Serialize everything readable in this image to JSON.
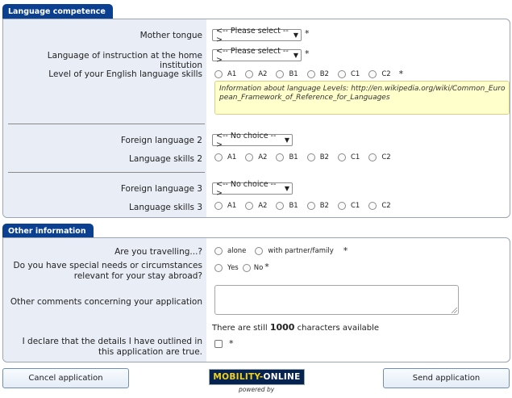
{
  "language_section": {
    "title": "Language competence",
    "mother_tongue": {
      "label": "Mother tongue",
      "value": "<-- Please select -->",
      "required": "*"
    },
    "instruction_language": {
      "label": "Language of instruction at the home institution",
      "value": "<-- Please select -->",
      "required": "*"
    },
    "english_skills": {
      "label": "Level of your English language skills",
      "options": [
        "A1",
        "A2",
        "B1",
        "B2",
        "C1",
        "C2"
      ],
      "required": "*"
    },
    "info_box": "Information about language Levels: http://en.wikipedia.org/wiki/Common_European_Framework_of_Reference_for_Languages",
    "foreign_language_2": {
      "label": "Foreign language 2",
      "value": "<-- No choice -->"
    },
    "language_skills_2": {
      "label": "Language skills 2",
      "options": [
        "A1",
        "A2",
        "B1",
        "B2",
        "C1",
        "C2"
      ]
    },
    "foreign_language_3": {
      "label": "Foreign language 3",
      "value": "<-- No choice -->"
    },
    "language_skills_3": {
      "label": "Language skills 3",
      "options": [
        "A1",
        "A2",
        "B1",
        "B2",
        "C1",
        "C2"
      ]
    }
  },
  "other_section": {
    "title": "Other information",
    "travelling": {
      "label": "Are you travelling...?",
      "options": [
        "alone",
        "with partner/family"
      ],
      "required": "*"
    },
    "special_needs": {
      "label": "Do you have special needs or circumstances relevant for your stay abroad?",
      "options": [
        "Yes",
        "No"
      ],
      "required": "*"
    },
    "comments": {
      "label": "Other comments concerning your application",
      "value": ""
    },
    "chars_prefix": "There are still",
    "chars_count": "1000",
    "chars_suffix": "characters available",
    "declaration": {
      "label": "I declare that the details I have outlined in this application are true.",
      "required": "*"
    }
  },
  "footer": {
    "cancel_label": "Cancel application",
    "send_label": "Send application",
    "logo_part1": "MOBILITY-",
    "logo_part2": "ONLINE",
    "powered_by": "powered by"
  },
  "colors": {
    "tab": "#0b3f8f",
    "label_bg": "#e9eef6",
    "info_bg": "#ffffcc"
  }
}
